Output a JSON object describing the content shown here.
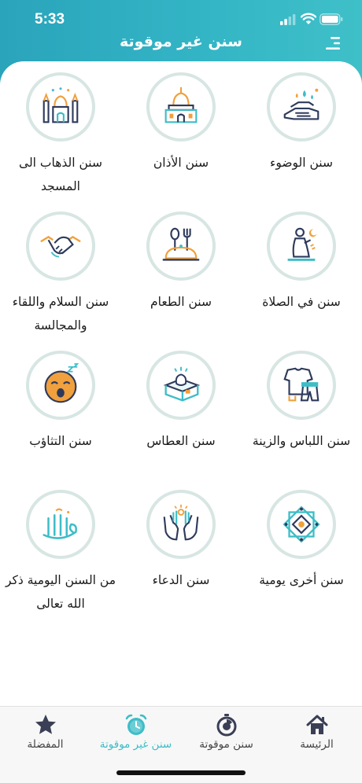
{
  "status_bar": {
    "time": "5:33"
  },
  "header": {
    "title": "سنن غير موقوتة"
  },
  "grid": {
    "items": [
      {
        "label": "سنن الوضوء",
        "icon": "wudu-hands-icon"
      },
      {
        "label": "سنن الأذان",
        "icon": "mosque-dome-icon"
      },
      {
        "label": "سنن الذهاب الى المسجد",
        "icon": "mosque-minarets-icon"
      },
      {
        "label": "سنن في الصلاة",
        "icon": "praying-man-icon"
      },
      {
        "label": "سنن الطعام",
        "icon": "food-spoon-fork-icon"
      },
      {
        "label": "سنن السلام واللقاء والمجالسة",
        "icon": "handshake-icon"
      },
      {
        "label": "سنن اللباس والزينة",
        "icon": "clothes-icon"
      },
      {
        "label": "سنن العطاس",
        "icon": "tissue-box-icon"
      },
      {
        "label": "سنن التثاؤب",
        "icon": "yawning-face-icon"
      },
      {
        "label": "سنن أخرى يومية",
        "icon": "islamic-pattern-icon"
      },
      {
        "label": "سنن الدعاء",
        "icon": "dua-hands-icon"
      },
      {
        "label": "من السنن اليومية ذكر الله تعالى",
        "icon": "allah-calligraphy-icon"
      }
    ]
  },
  "tabbar": {
    "tabs": [
      {
        "label": "الرئيسة",
        "icon": "home-icon",
        "active": false
      },
      {
        "label": "سنن موقوتة",
        "icon": "timer-icon",
        "active": false
      },
      {
        "label": "سنن غير موقوتة",
        "icon": "alarm-clock-icon",
        "active": true
      },
      {
        "label": "المفضلة",
        "icon": "star-icon",
        "active": false
      }
    ]
  },
  "colors": {
    "accent": "#3dbdc7",
    "header": "#2aa8bd",
    "icon_orange": "#f0a03c",
    "icon_navy": "#2e3a5c"
  }
}
